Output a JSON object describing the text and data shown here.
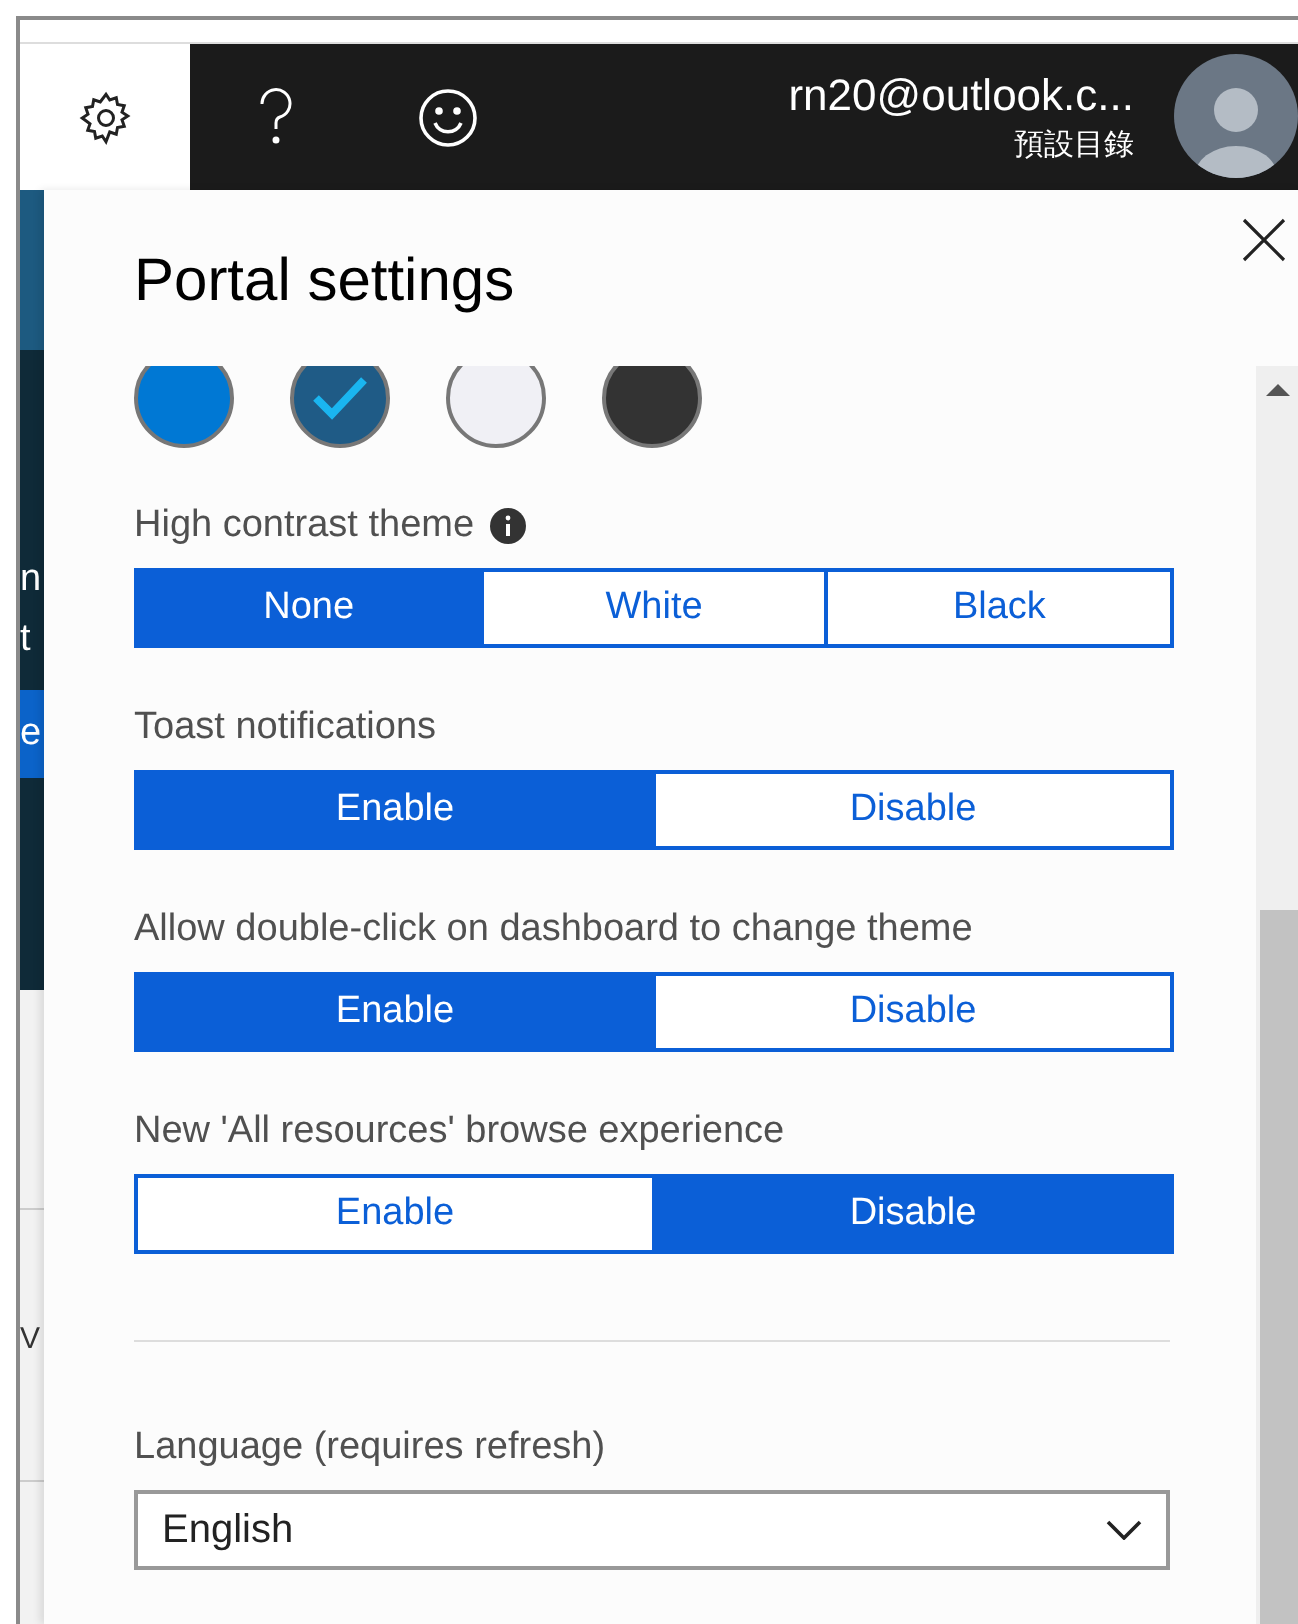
{
  "background_fragments": [
    {
      "text": "n",
      "kind": "plain"
    },
    {
      "text": "t",
      "kind": "plain"
    },
    {
      "text": "e",
      "kind": "highlight"
    },
    {
      "text": "V",
      "kind": "light"
    }
  ],
  "account": {
    "email": "rn20@outlook.c...",
    "directory": "預設目錄"
  },
  "panel": {
    "title": "Portal settings",
    "themes": [
      {
        "color": "#0078d4",
        "selected": false
      },
      {
        "color": "#1f5b86",
        "selected": true
      },
      {
        "color": "#f0f0f5",
        "selected": false
      },
      {
        "color": "#333333",
        "selected": false
      }
    ],
    "settings": [
      {
        "label": "High contrast theme",
        "info": true,
        "options": [
          {
            "label": "None",
            "selected": true
          },
          {
            "label": "White",
            "selected": false
          },
          {
            "label": "Black",
            "selected": false
          }
        ]
      },
      {
        "label": "Toast notifications",
        "info": false,
        "options": [
          {
            "label": "Enable",
            "selected": true
          },
          {
            "label": "Disable",
            "selected": false
          }
        ]
      },
      {
        "label": "Allow double-click on dashboard to change theme",
        "info": false,
        "options": [
          {
            "label": "Enable",
            "selected": true
          },
          {
            "label": "Disable",
            "selected": false
          }
        ]
      },
      {
        "label": "New 'All resources' browse experience",
        "info": false,
        "options": [
          {
            "label": "Enable",
            "selected": false
          },
          {
            "label": "Disable",
            "selected": true
          }
        ]
      }
    ],
    "language": {
      "label": "Language (requires refresh)",
      "value": "English"
    }
  }
}
